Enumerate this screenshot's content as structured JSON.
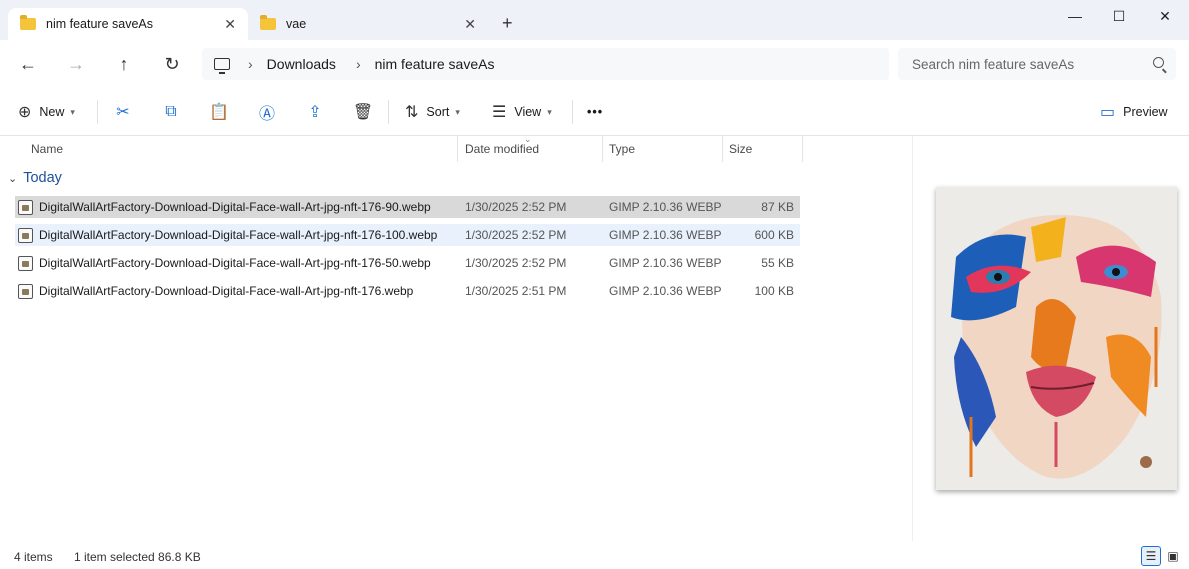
{
  "tabs": [
    {
      "label": "nim feature saveAs",
      "icon": "folder-icon",
      "active": true
    },
    {
      "label": "vae",
      "icon": "folder-icon",
      "active": false
    }
  ],
  "new_tab_symbol": "+",
  "window_controls": {
    "minimize": "—",
    "maximize": "☐",
    "close": "✕"
  },
  "nav": {
    "back": "←",
    "forward": "→",
    "up": "↑",
    "refresh": "↻"
  },
  "breadcrumb": [
    "Downloads",
    "nim feature saveAs"
  ],
  "breadcrumb_sep": "›",
  "search": {
    "placeholder": "Search nim feature saveAs"
  },
  "toolbar": {
    "new_label": "New",
    "sort_label": "Sort",
    "view_label": "View",
    "more_label": "•••",
    "preview_label": "Preview",
    "icons": [
      "plus-circle-icon",
      "cut-icon",
      "copy-icon",
      "paste-icon",
      "rename-icon",
      "share-icon",
      "delete-icon",
      "sort-icon",
      "view-icon",
      "preview-pane-icon"
    ]
  },
  "columns": {
    "name": "Name",
    "date": "Date modified",
    "type": "Type",
    "size": "Size"
  },
  "group": {
    "label": "Today"
  },
  "files": [
    {
      "name": "DigitalWallArtFactory-Download-Digital-Face-wall-Art-jpg-nft-176-90.webp",
      "date": "1/30/2025 2:52 PM",
      "type": "GIMP 2.10.36 WEBP",
      "size": "87 KB"
    },
    {
      "name": "DigitalWallArtFactory-Download-Digital-Face-wall-Art-jpg-nft-176-100.webp",
      "date": "1/30/2025 2:52 PM",
      "type": "GIMP 2.10.36 WEBP",
      "size": "600 KB"
    },
    {
      "name": "DigitalWallArtFactory-Download-Digital-Face-wall-Art-jpg-nft-176-50.webp",
      "date": "1/30/2025 2:52 PM",
      "type": "GIMP 2.10.36 WEBP",
      "size": "55 KB"
    },
    {
      "name": "DigitalWallArtFactory-Download-Digital-Face-wall-Art-jpg-nft-176.webp",
      "date": "1/30/2025 2:51 PM",
      "type": "GIMP 2.10.36 WEBP",
      "size": "100 KB"
    }
  ],
  "status": {
    "count": "4 items",
    "selection": "1 item selected  86.8 KB"
  },
  "colors": {
    "accent": "#1f6fd0",
    "selected_row": "#d9d9d9",
    "hover_row": "#e8f1fc",
    "titlebar": "#eef2f8"
  }
}
